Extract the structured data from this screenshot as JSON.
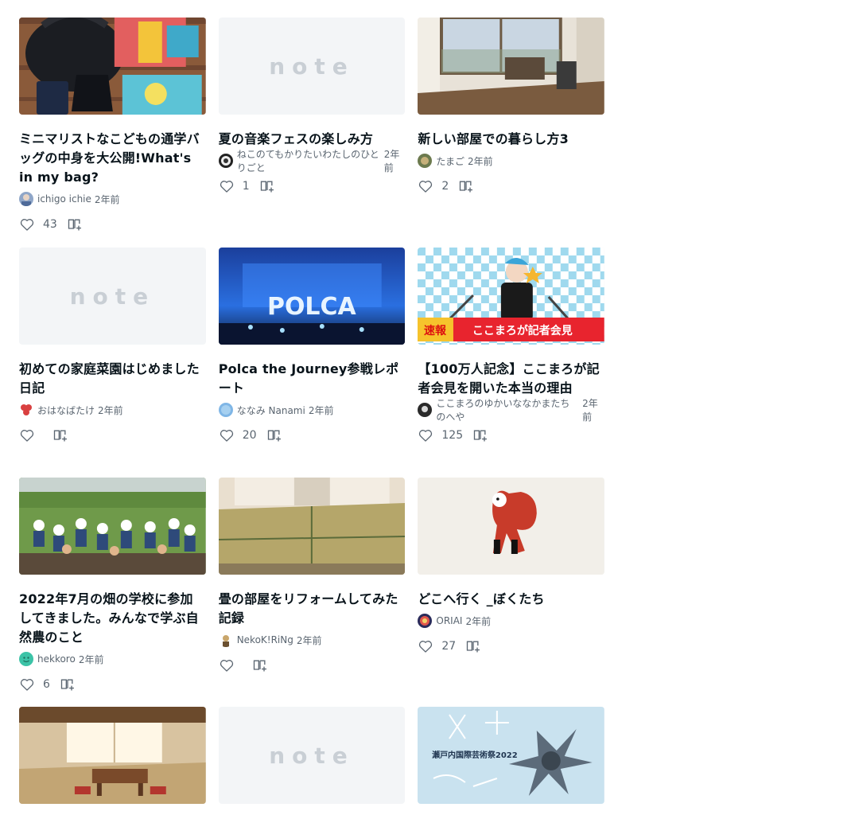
{
  "colors": {
    "text": "#08131a",
    "meta": "#5a6570",
    "placeholder_bg": "#f3f5f7",
    "placeholder_logo": "#c9cfd5"
  },
  "placeholder_logo_text": "note",
  "rows": [
    [
      {
        "title": "ミニマリストなこどもの通学バッグの中身を大公開!What's in my bag?",
        "author": "ichigo ichie",
        "time": "2年前",
        "likes": "43",
        "thumb": "bag",
        "avatar": "a1"
      },
      {
        "title": "夏の音楽フェスの楽しみ方",
        "author": "ねこのてもかりたいわたしのひとりごと",
        "time": "2年前",
        "likes": "1",
        "thumb": "placeholder",
        "avatar": "a2"
      },
      {
        "title": "新しい部屋での暮らし方3",
        "author": "たまご",
        "time": "2年前",
        "likes": "2",
        "thumb": "room",
        "avatar": "a3"
      }
    ],
    [
      {
        "title": "初めての家庭菜園はじめました日記",
        "author": "おはなばたけ",
        "time": "2年前",
        "likes": "",
        "thumb": "placeholder",
        "avatar": "a4"
      },
      {
        "title": "Polca the Journey参戦レポート",
        "author": "ななみ Nanami",
        "time": "2年前",
        "likes": "20",
        "thumb": "concert",
        "avatar": "a5"
      },
      {
        "title": "【100万人記念】ここまろが記者会見を開いた本当の理由",
        "author": "ここまろのゆかいななかまたちのへや",
        "time": "2年前",
        "likes": "125",
        "thumb": "press",
        "avatar": "a6"
      }
    ],
    [
      {
        "title": "2022年7月の畑の学校に参加してきました。みんなで学ぶ自然農のこと",
        "author": "hekkoro",
        "time": "2年前",
        "likes": "6",
        "thumb": "farm",
        "avatar": "a7"
      },
      {
        "title": "畳の部屋をリフォームしてみた記録",
        "author": "NekoK!RiNg",
        "time": "2年前",
        "likes": "",
        "thumb": "tatami",
        "avatar": "a8"
      },
      {
        "title": "どこへ行く _ぼくたち",
        "author": "ORIAI",
        "time": "2年前",
        "likes": "27",
        "thumb": "illust",
        "avatar": "a9"
      }
    ],
    [
      {
        "title": "",
        "author": "",
        "time": "",
        "likes": "",
        "thumb": "room2",
        "avatar": ""
      },
      {
        "title": "",
        "author": "",
        "time": "",
        "likes": "",
        "thumb": "placeholder",
        "avatar": ""
      },
      {
        "title": "",
        "author": "",
        "time": "",
        "likes": "",
        "thumb": "poster",
        "avatar": ""
      }
    ]
  ],
  "poster_text": "瀬戸内国際芸術祭2022",
  "press_banner": {
    "tag": "速報",
    "text": "ここまろが記者会見"
  },
  "concert_text": "POLCA"
}
